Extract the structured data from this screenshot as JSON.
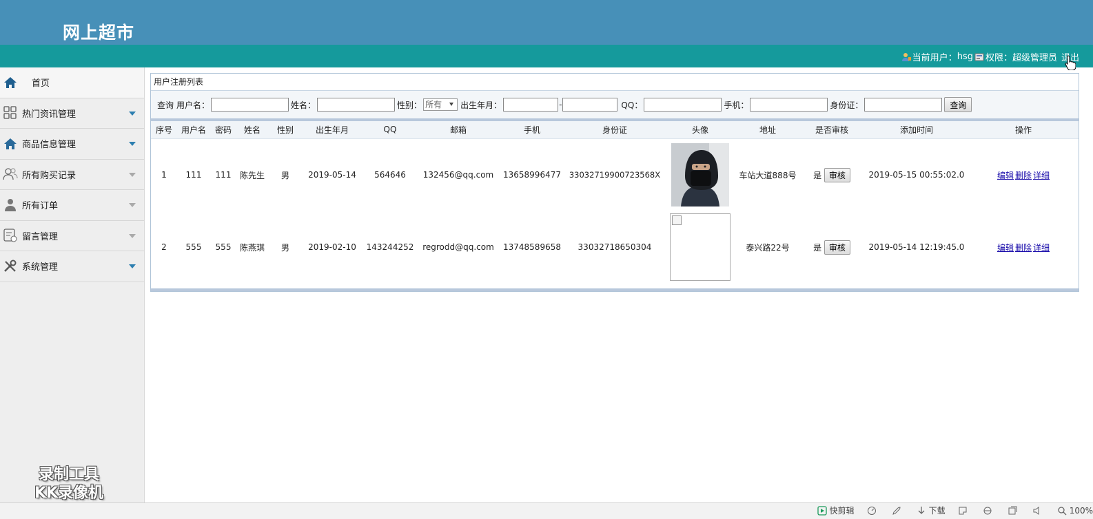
{
  "header": {
    "title": "网上超市"
  },
  "userbar": {
    "current_user_label": "当前用户：",
    "username": "hsg",
    "role_label": "权限：",
    "role": "超级管理员",
    "logout": "退出"
  },
  "sidebar": {
    "items": [
      {
        "label": "首页",
        "icon": "home-icon"
      },
      {
        "label": "热门资讯管理",
        "icon": "grid-icon"
      },
      {
        "label": "商品信息管理",
        "icon": "house-icon"
      },
      {
        "label": "所有购买记录",
        "icon": "users-icon"
      },
      {
        "label": "所有订单",
        "icon": "user-icon"
      },
      {
        "label": "留言管理",
        "icon": "message-icon"
      },
      {
        "label": "系统管理",
        "icon": "tools-icon"
      }
    ]
  },
  "watermark": {
    "line1": "录制工具",
    "line2": "KK录像机"
  },
  "panel": {
    "title": "用户注册列表",
    "search": {
      "prefix": "查询",
      "username_label": "用户名：",
      "name_label": "姓名：",
      "gender_label": "性别：",
      "gender_value": "所有",
      "birth_label": "出生年月：",
      "qq_label": "QQ：",
      "phone_label": "手机：",
      "idcard_label": "身份证：",
      "submit": "查询"
    },
    "columns": [
      "序号",
      "用户名",
      "密码",
      "姓名",
      "性别",
      "出生年月",
      "QQ",
      "邮箱",
      "手机",
      "身份证",
      "头像",
      "地址",
      "是否审核",
      "添加时间",
      "操作"
    ],
    "rows": [
      {
        "idx": "1",
        "username": "111",
        "password": "111",
        "name": "陈先生",
        "gender": "男",
        "birth": "2019-05-14",
        "qq": "564646",
        "email": "132456@qq.com",
        "phone": "13658996477",
        "idcard": "33032719900723568X",
        "address": "车站大道888号",
        "audited": "是",
        "audit_btn": "审核",
        "added": "2019-05-15 00:55:02.0",
        "edit": "编辑",
        "delete": "删除",
        "detail": "详细"
      },
      {
        "idx": "2",
        "username": "555",
        "password": "555",
        "name": "陈燕琪",
        "gender": "男",
        "birth": "2019-02-10",
        "qq": "143244252",
        "email": "regrodd@qq.com",
        "phone": "13748589658",
        "idcard": "33032718650304",
        "address": "泰兴路22号",
        "audited": "是",
        "audit_btn": "审核",
        "added": "2019-05-14 12:19:45.0",
        "edit": "编辑",
        "delete": "删除",
        "detail": "详细"
      }
    ]
  },
  "statusbar": {
    "quick_edit": "快剪辑",
    "download": "下载",
    "zoom": "100%"
  },
  "colors": {
    "header": "#4790b8",
    "userbar": "#159a9c",
    "sidebar": "#eeeeee",
    "caret": "#2d7fb0"
  }
}
